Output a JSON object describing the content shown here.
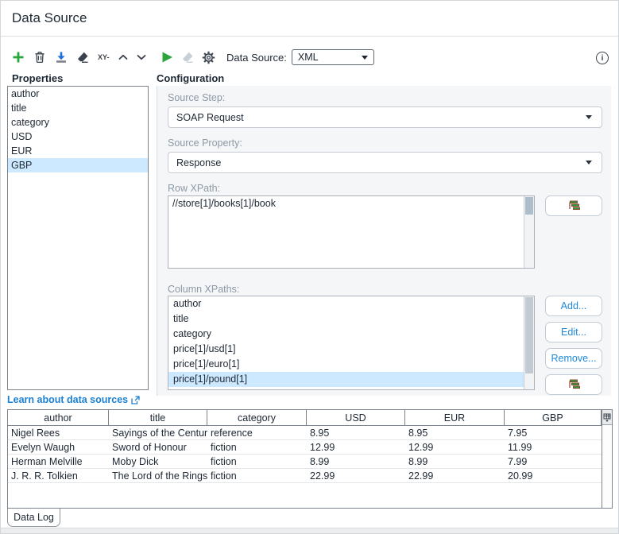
{
  "window": {
    "title": "Data Source"
  },
  "toolbar": {
    "data_source_label": "Data Source:",
    "data_source_value": "XML",
    "xy_glyph": "XY-"
  },
  "icons": {
    "add": "plus",
    "remove": "trash",
    "import": "arrow-down-to-bar",
    "clear": "eraser",
    "move_up": "chevron-up",
    "move_down": "chevron-down",
    "run": "play-triangle",
    "clear_run": "eraser-disabled",
    "options": "gear",
    "info": "i-in-circle",
    "external_link": "box-with-arrow",
    "select_xpath": "green-tree-staircase",
    "table_options": "grid-with-arrow"
  },
  "properties_panel": {
    "heading": "Properties",
    "items": [
      "author",
      "title",
      "category",
      "USD",
      "EUR",
      "GBP"
    ],
    "selected": "GBP",
    "link_label": "Learn about data sources"
  },
  "configuration": {
    "heading": "Configuration",
    "source_step": {
      "label": "Source Step:",
      "value": "SOAP Request"
    },
    "source_property": {
      "label": "Source Property:",
      "value": "Response"
    },
    "row_xpath": {
      "label": "Row XPath:",
      "value": "//store[1]/books[1]/book"
    },
    "column_xpaths": {
      "label": "Column XPaths:",
      "items": [
        "author",
        "title",
        "category",
        "price[1]/usd[1]",
        "price[1]/euro[1]",
        "price[1]/pound[1]"
      ],
      "selected": "price[1]/pound[1]"
    },
    "buttons": {
      "add": "Add...",
      "edit": "Edit...",
      "remove": "Remove..."
    }
  },
  "data_table": {
    "columns": [
      "author",
      "title",
      "category",
      "USD",
      "EUR",
      "GBP"
    ],
    "rows": [
      [
        "Nigel Rees",
        "Sayings of the Century",
        "reference",
        "8.95",
        "8.95",
        "7.95"
      ],
      [
        "Evelyn Waugh",
        "Sword of Honour",
        "fiction",
        "12.99",
        "12.99",
        "11.99"
      ],
      [
        "Herman Melville",
        "Moby Dick",
        "fiction",
        "8.99",
        "8.99",
        "7.99"
      ],
      [
        "J. R. R. Tolkien",
        "The Lord of the Rings",
        "fiction",
        "22.99",
        "22.99",
        "20.99"
      ]
    ]
  },
  "footer": {
    "tab_label": "Data Log"
  },
  "colors": {
    "accent_green": "#2aa63c",
    "accent_blue": "#1e88d8",
    "link_blue": "#1b80d2",
    "selection": "#cde9ff",
    "panel_bg": "#f4f6f8",
    "icon_dark": "#39424d",
    "tree_icon_green": "#2f9e3f",
    "tree_icon_outline": "#8a3c28"
  }
}
